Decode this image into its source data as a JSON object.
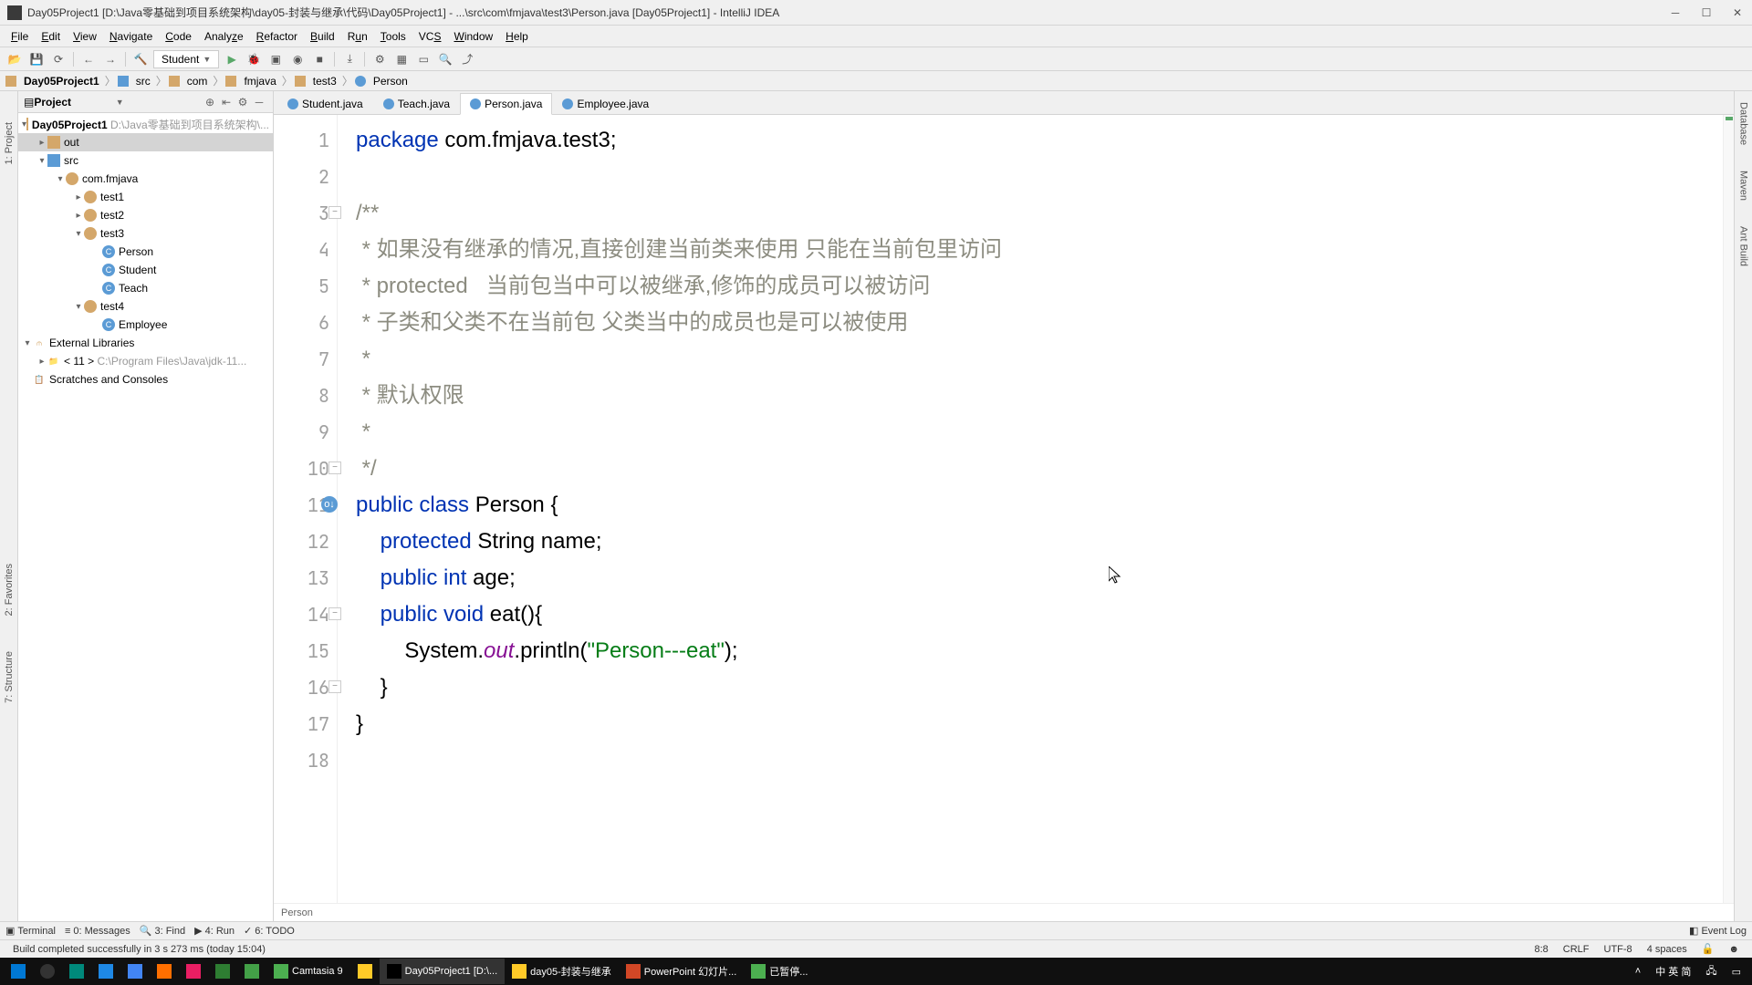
{
  "window": {
    "title": "Day05Project1 [D:\\Java零基础到项目系统架构\\day05-封装与继承\\代码\\Day05Project1] - ...\\src\\com\\fmjava\\test3\\Person.java [Day05Project1] - IntelliJ IDEA"
  },
  "menu": [
    "File",
    "Edit",
    "View",
    "Navigate",
    "Code",
    "Analyze",
    "Refactor",
    "Build",
    "Run",
    "Tools",
    "VCS",
    "Window",
    "Help"
  ],
  "run_config": "Student",
  "breadcrumb": [
    "Day05Project1",
    "src",
    "com",
    "fmjava",
    "test3",
    "Person"
  ],
  "project": {
    "title": "Project",
    "root": "Day05Project1",
    "root_path": "D:\\Java零基础到项目系统架构\\...",
    "tree": {
      "out": "out",
      "src": "src",
      "pkg": "com.fmjava",
      "test1": "test1",
      "test2": "test2",
      "test3": "test3",
      "Person": "Person",
      "Student": "Student",
      "Teach": "Teach",
      "test4": "test4",
      "Employee": "Employee",
      "external": "External Libraries",
      "jdk": "< 11 >",
      "jdk_path": "C:\\Program Files\\Java\\jdk-11...",
      "scratches": "Scratches and Consoles"
    }
  },
  "tabs": [
    {
      "label": "Student.java",
      "active": false
    },
    {
      "label": "Teach.java",
      "active": false
    },
    {
      "label": "Person.java",
      "active": true
    },
    {
      "label": "Employee.java",
      "active": false
    }
  ],
  "breadcrumb_editor": "Person",
  "code": {
    "l1_kw": "package",
    "l1_pkg": "com.fmjava.test3",
    "l3": "/**",
    "l4": " * 如果没有继承的情况,直接创建当前类来使用 只能在当前包里访问",
    "l5": " * protected   当前包当中可以被继承,修饰的成员可以被访问",
    "l6": " * 子类和父类不在当前包 父类当中的成员也是可以被使用",
    "l7": " *",
    "l8": " * 默认权限",
    "l9": " *",
    "l10": " */",
    "l11_kw": "public class",
    "l11_cls": "Person",
    "l11_brace": " {",
    "l12_kw": "protected ",
    "l12_type": "String",
    "l12_rest": " name;",
    "l13_kw": "public int",
    "l13_rest": " age;",
    "l14_kw": "public void",
    "l14_rest": " eat(){",
    "l15_qual": "System.",
    "l15_fld": "out",
    "l15_call": ".println(",
    "l15_str": "\"Person---eat\"",
    "l15_end": ");",
    "l16": "    }",
    "l17": "}"
  },
  "bottom_tools": {
    "terminal": "Terminal",
    "messages": "0: Messages",
    "find": "3: Find",
    "run": "4: Run",
    "todo": "6: TODO",
    "eventlog": "Event Log"
  },
  "status": {
    "message": "Build completed successfully in 3 s 273 ms (today 15:04)",
    "pos": "8:8",
    "sep": "CRLF",
    "enc": "UTF-8",
    "indent": "4 spaces",
    "lock": "🔓"
  },
  "right_tabs": [
    "Database",
    "Maven",
    "Ant Build"
  ],
  "left_tabs": {
    "project": "1: Project",
    "favorites": "2: Favorites",
    "structure": "7: Structure"
  },
  "taskbar": {
    "items": [
      {
        "label": "",
        "ico": "#0078d4"
      },
      {
        "label": "",
        "ico": "#333"
      },
      {
        "label": "",
        "ico": "#00897b"
      },
      {
        "label": "",
        "ico": "#1e88e5"
      },
      {
        "label": "",
        "ico": "#4285f4"
      },
      {
        "label": "",
        "ico": "#ff6f00"
      },
      {
        "label": "",
        "ico": "#e91e63"
      },
      {
        "label": "",
        "ico": "#2e7d32"
      },
      {
        "label": "",
        "ico": "#43a047"
      },
      {
        "label": "Camtasia 9",
        "ico": "#4caf50"
      },
      {
        "label": "",
        "ico": "#ffca28"
      },
      {
        "label": "Day05Project1 [D:\\...",
        "ico": "#000",
        "active": true
      },
      {
        "label": "day05-封装与继承",
        "ico": "#ffca28"
      },
      {
        "label": "PowerPoint 幻灯片...",
        "ico": "#d24726"
      },
      {
        "label": "已暂停...",
        "ico": "#4caf50"
      }
    ],
    "tray": {
      "time": "",
      "ime": "中 英 简"
    }
  }
}
